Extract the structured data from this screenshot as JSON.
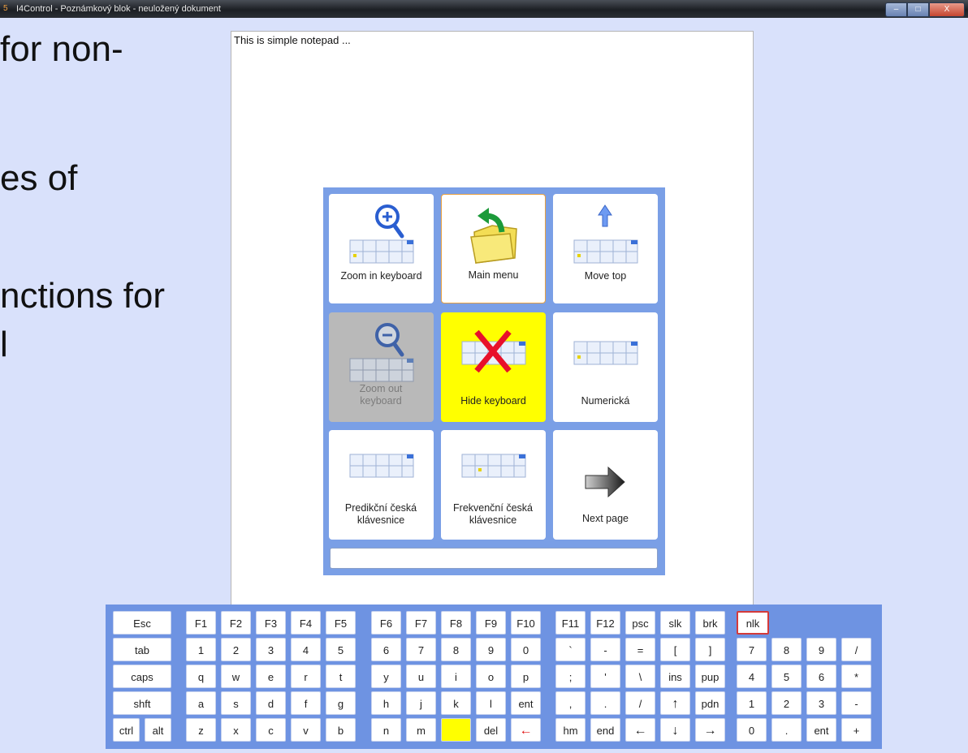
{
  "window": {
    "title": "I4Control - Poznámkový blok - neuložený dokument",
    "buttons": {
      "minimize": "–",
      "maximize": "□",
      "close": "X"
    }
  },
  "background_slide": {
    "lines": [
      "for non-",
      "es of",
      "nctions for",
      "l"
    ]
  },
  "notepad": {
    "text": "This is simple notepad ..."
  },
  "menu": {
    "tiles": [
      {
        "label": "Zoom in keyboard",
        "icon": "zoom-in-keyboard-icon",
        "state": "normal"
      },
      {
        "label": "Main menu",
        "icon": "folder-back-icon",
        "state": "selected"
      },
      {
        "label": "Move top",
        "icon": "move-top-icon",
        "state": "normal"
      },
      {
        "label": "Zoom out keyboard",
        "icon": "zoom-out-keyboard-icon",
        "state": "disabled"
      },
      {
        "label": "Hide keyboard",
        "icon": "hide-keyboard-icon",
        "state": "highlighted"
      },
      {
        "label": "Numerická",
        "icon": "numeric-keyboard-icon",
        "state": "normal"
      },
      {
        "label": "Predikční česká klávesnice",
        "icon": "predictive-keyboard-icon",
        "state": "normal"
      },
      {
        "label": "Frekvenční česká klávesnice",
        "icon": "frequency-keyboard-icon",
        "state": "normal"
      },
      {
        "label": "Next page",
        "icon": "next-arrow-icon",
        "state": "normal"
      }
    ],
    "status_text": ""
  },
  "keyboard": {
    "rows": [
      [
        "Esc",
        "F1",
        "F2",
        "F3",
        "F4",
        "F5",
        "F6",
        "F7",
        "F8",
        "F9",
        "F10",
        "F11",
        "F12",
        "psc",
        "slk",
        "brk",
        "nlk"
      ],
      [
        "tab",
        "1",
        "2",
        "3",
        "4",
        "5",
        "6",
        "7",
        "8",
        "9",
        "0",
        "`",
        "-",
        "=",
        "[",
        "]",
        "7",
        "8",
        "9",
        "/"
      ],
      [
        "caps",
        "q",
        "w",
        "e",
        "r",
        "t",
        "y",
        "u",
        "i",
        "o",
        "p",
        ";",
        "'",
        "\\",
        "ins",
        "pup",
        "4",
        "5",
        "6",
        "*"
      ],
      [
        "shft",
        "a",
        "s",
        "d",
        "f",
        "g",
        "h",
        "j",
        "k",
        "l",
        "ent",
        ",",
        ".",
        "/",
        "↑",
        "pdn",
        "1",
        "2",
        "3",
        "-"
      ],
      [
        "ctrl",
        "alt",
        "z",
        "x",
        "c",
        "v",
        "b",
        "n",
        "m",
        "",
        "del",
        "←",
        "hm",
        "end",
        "←",
        "↓",
        "→",
        "0",
        ".",
        "ent",
        "+"
      ]
    ],
    "colors": {
      "panel": "#6e93e2",
      "highlight": "#ffff00",
      "active_border": "#d43a3a"
    }
  }
}
